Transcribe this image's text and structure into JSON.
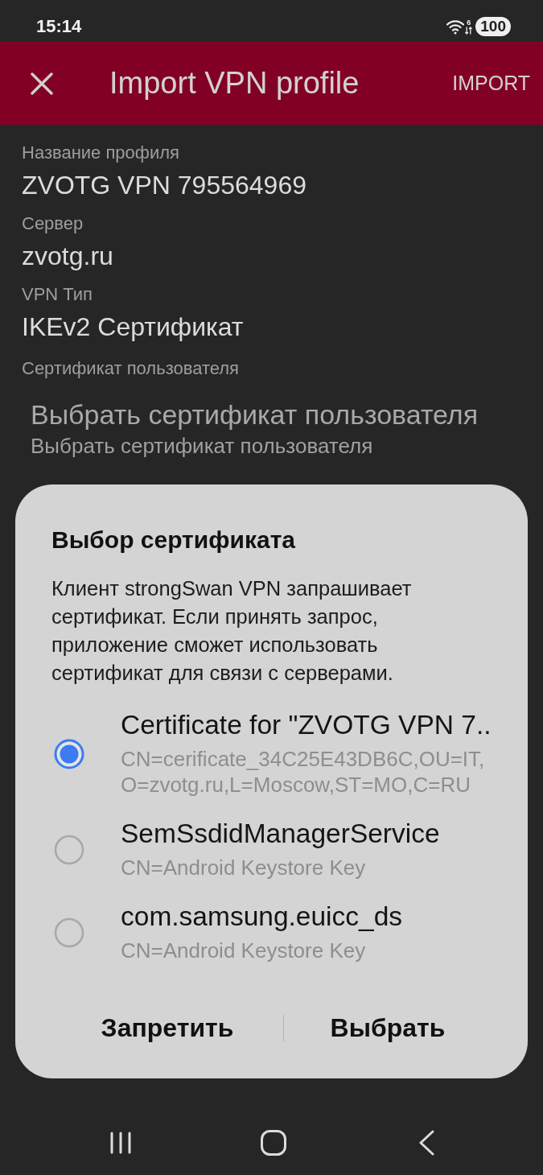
{
  "status_bar": {
    "time": "15:14",
    "wifi_badge": "6",
    "battery": "100"
  },
  "app_bar": {
    "title": "Import VPN profile",
    "action": "IMPORT"
  },
  "form": {
    "fields": [
      {
        "label": "Название профиля",
        "value": "ZVOTG VPN 795564969"
      },
      {
        "label": "Сервер",
        "value": "zvotg.ru"
      },
      {
        "label": "VPN Тип",
        "value": "IKEv2 Сертификат"
      }
    ],
    "user_certificate": {
      "label": "Сертификат пользователя",
      "title": "Выбрать сертификат пользователя",
      "subtitle": "Выбрать сертификат пользователя"
    }
  },
  "dialog": {
    "title": "Выбор сертификата",
    "message": "Клиент strongSwan VPN запрашивает сертификат. Если принять запрос, приложение сможет использовать сертификат для связи с серверами.",
    "options": [
      {
        "title": "Certificate for \"ZVOTG VPN 7..",
        "details": [
          "CN=cerificate_34C25E43DB6C,OU=IT,",
          "O=zvotg.ru,L=Moscow,ST=MO,C=RU"
        ],
        "selected": true
      },
      {
        "title": "SemSsdidManagerService",
        "details": [
          "CN=Android Keystore Key"
        ],
        "selected": false
      },
      {
        "title": "com.samsung.euicc_ds",
        "details": [
          "CN=Android Keystore Key"
        ],
        "selected": false
      }
    ],
    "buttons": [
      "Запретить",
      "Выбрать"
    ]
  }
}
